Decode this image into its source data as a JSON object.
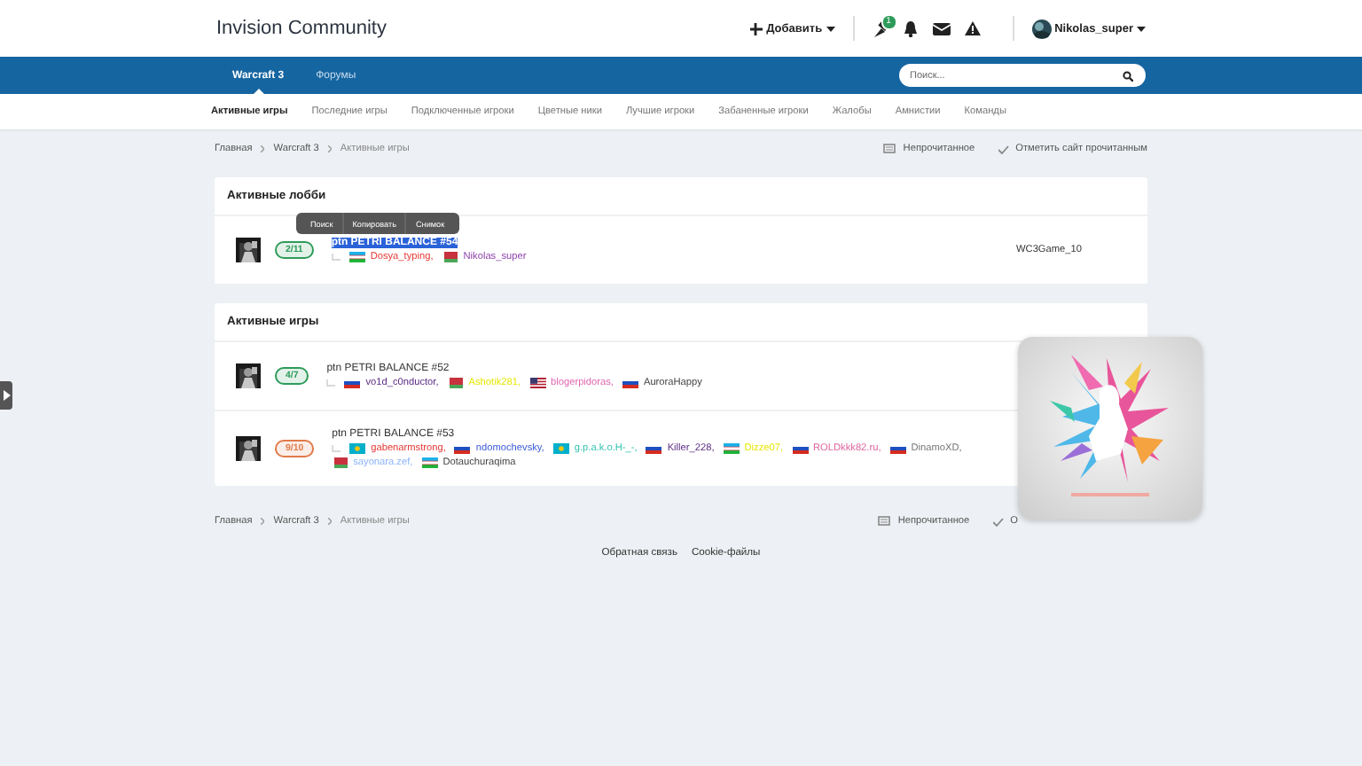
{
  "header": {
    "title": "Invision Community",
    "add_button": "Добавить",
    "notification_count": "1",
    "username": "Nikolas_super"
  },
  "nav": {
    "items": [
      {
        "label": "Warcraft 3",
        "selected": true
      },
      {
        "label": "Форумы",
        "selected": false
      }
    ],
    "search": {
      "placeholder": "Поиск..."
    }
  },
  "subnav": [
    {
      "label": "Активные игры",
      "selected": true
    },
    {
      "label": "Последние игры",
      "selected": false
    },
    {
      "label": "Подключенные игроки",
      "selected": false
    },
    {
      "label": "Цветные ники",
      "selected": false
    },
    {
      "label": "Лучшие игроки",
      "selected": false
    },
    {
      "label": "Забаненные игроки",
      "selected": false
    },
    {
      "label": "Жалобы",
      "selected": false
    },
    {
      "label": "Амнистии",
      "selected": false
    },
    {
      "label": "Команды",
      "selected": false
    }
  ],
  "breadcrumb_top": {
    "path": [
      "Главная",
      "Warcraft 3",
      "Активные игры"
    ],
    "unread": "Непрочитанное",
    "mark_read": "Отметить сайт прочитанным"
  },
  "lobbies": {
    "title": "Активные лобби",
    "rows": [
      {
        "slots": {
          "text": "2/11",
          "color": "#2e9b5a"
        },
        "name": "ptn PETRI BALANCE #54",
        "text_selected": true,
        "host": "WC3Game_10",
        "players": [
          {
            "name": "Dosya_typing,",
            "kind": "uz",
            "color": "#e53935"
          },
          {
            "name": "Nikolas_super",
            "kind": "by",
            "color": "#8e44ad"
          }
        ]
      }
    ]
  },
  "context_menu": [
    "Поиск",
    "Копировать",
    "Снимок"
  ],
  "games": {
    "title": "Активные игры",
    "rows": [
      {
        "slots": {
          "text": "4/7",
          "color": "#2e9b5a"
        },
        "name": "ptn PETRI BALANCE #52",
        "text_selected": false,
        "players": [
          {
            "name": "vo1d_c0nductor,",
            "kind": "ru",
            "color": "#5b2c83"
          },
          {
            "name": "Ashotik281,",
            "kind": "by",
            "color": "#e6e600"
          },
          {
            "name": "blogerpidoras,",
            "kind": "us",
            "color": "#e066b0"
          },
          {
            "name": "AuroraHappy",
            "kind": "ru",
            "color": "#444444"
          }
        ]
      },
      {
        "slots": {
          "text": "9/10",
          "color": "#e07a4a"
        },
        "name": "ptn PETRI BALANCE #53",
        "text_selected": false,
        "players": [
          {
            "name": "gabenarmstrong,",
            "kind": "kz",
            "color": "#e53935"
          },
          {
            "name": "ndomochevsky,",
            "kind": "ru",
            "color": "#3b5bdb"
          },
          {
            "name": "g.p.a.k.o.H-_-,",
            "kind": "kz",
            "color": "#33c2b0"
          },
          {
            "name": "Killer_228,",
            "kind": "ru",
            "color": "#5b2c83"
          },
          {
            "name": "Dizze07,",
            "kind": "uz",
            "color": "#e6e600"
          },
          {
            "name": "ROLDkkk82.ru,",
            "kind": "ru",
            "color": "#e066a0"
          },
          {
            "name": "DinamoXD,",
            "kind": "ru",
            "color": "#777777"
          },
          {
            "name": "sayonara.zef,",
            "kind": "by",
            "color": "#8ab4f8"
          },
          {
            "name": "Dotauchuraqima",
            "kind": "uz",
            "color": "#444444"
          }
        ]
      }
    ]
  },
  "breadcrumb_bottom": {
    "path": [
      "Главная",
      "Warcraft 3",
      "Активные игры"
    ],
    "unread": "Непрочитанное",
    "mark_read": "О"
  },
  "footer": [
    "Обратная связь",
    "Cookie-файлы"
  ],
  "popup": {
    "kind": "picture"
  }
}
